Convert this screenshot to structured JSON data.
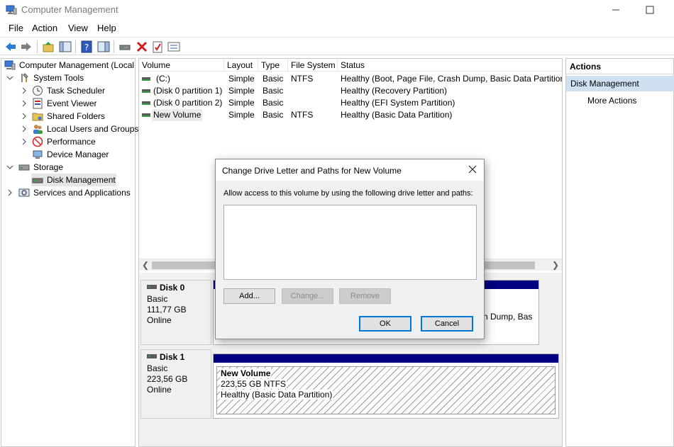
{
  "window": {
    "title": "Computer Management"
  },
  "menu": [
    "File",
    "Action",
    "View",
    "Help"
  ],
  "tree": {
    "items": [
      {
        "label": "Computer Management (Local",
        "icon": "computer-management-icon"
      },
      {
        "label": "System Tools",
        "icon": "system-tools-icon"
      },
      {
        "label": "Task Scheduler",
        "icon": "clock-icon"
      },
      {
        "label": "Event Viewer",
        "icon": "event-viewer-icon"
      },
      {
        "label": "Shared Folders",
        "icon": "shared-folder-icon"
      },
      {
        "label": "Local Users and Groups",
        "icon": "users-icon"
      },
      {
        "label": "Performance",
        "icon": "performance-icon"
      },
      {
        "label": "Device Manager",
        "icon": "device-manager-icon"
      },
      {
        "label": "Storage",
        "icon": "storage-icon"
      },
      {
        "label": "Disk Management",
        "icon": "disk-icon"
      },
      {
        "label": "Services and Applications",
        "icon": "services-icon"
      }
    ],
    "selected": "Disk Management"
  },
  "volumes": {
    "columns": [
      "Volume",
      "Layout",
      "Type",
      "File System",
      "Status"
    ],
    "rows": [
      {
        "volume": "(C:)",
        "layout": "Simple",
        "type": "Basic",
        "fs": "NTFS",
        "status": "Healthy (Boot, Page File, Crash Dump, Basic Data Partition)"
      },
      {
        "volume": "(Disk 0 partition 1)",
        "layout": "Simple",
        "type": "Basic",
        "fs": "",
        "status": "Healthy (Recovery Partition)"
      },
      {
        "volume": "(Disk 0 partition 2)",
        "layout": "Simple",
        "type": "Basic",
        "fs": "",
        "status": "Healthy (EFI System Partition)"
      },
      {
        "volume": "New Volume",
        "layout": "Simple",
        "type": "Basic",
        "fs": "NTFS",
        "status": "Healthy (Basic Data Partition)"
      }
    ]
  },
  "disks": [
    {
      "name": "Disk 0",
      "type": "Basic",
      "size": "111,77 GB",
      "state": "Online",
      "partial_text": "sh Dump, Bas"
    },
    {
      "name": "Disk 1",
      "type": "Basic",
      "size": "223,56 GB",
      "state": "Online",
      "volume": {
        "name": "New Volume",
        "size": "223,55 GB NTFS",
        "status": "Healthy (Basic Data Partition)"
      }
    }
  ],
  "actions": {
    "title": "Actions",
    "section": "Disk Management",
    "more": "More Actions"
  },
  "dialog": {
    "title": "Change Drive Letter and Paths for New Volume",
    "description": "Allow access to this volume by using the following drive letter and paths:",
    "add": "Add...",
    "change": "Change...",
    "remove": "Remove",
    "ok": "OK",
    "cancel": "Cancel"
  },
  "colors": {
    "accent": "#0078d7",
    "disk_bar": "#000080",
    "selection": "#cfe0f1"
  }
}
